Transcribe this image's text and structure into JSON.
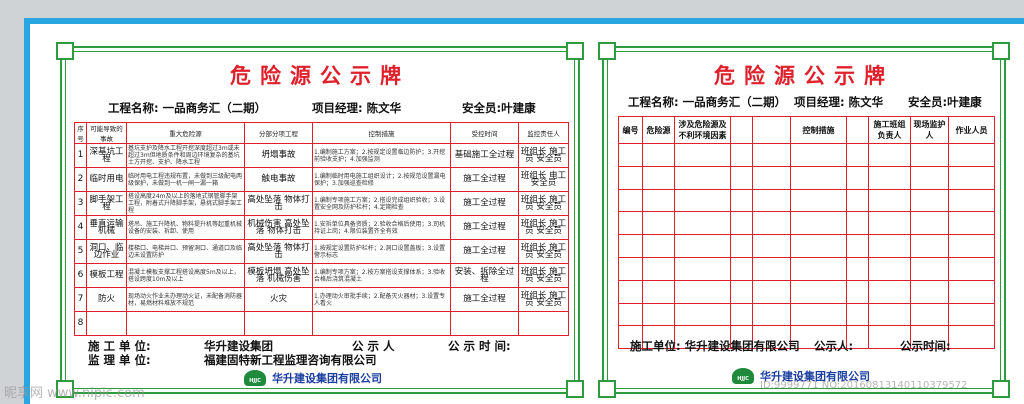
{
  "left": {
    "title": "危险源公示牌",
    "project": "工程名称: 一品商务汇（二期）",
    "manager": "项目经理: 陈文华",
    "safety_officer": "安全员:叶建康",
    "columns": [
      "序号",
      "可能导致的事故",
      "重大危险源",
      "分部分项工程",
      "控制措施",
      "受控时间",
      "监控责任人"
    ],
    "rows": [
      {
        "no": "1",
        "item": "深基坑工程",
        "hazard": "基坑支护及降水工程开挖深度超过3m或未超过3m但地质条件和周边环境复杂的基坑土方开挖、支护、降水工程",
        "sub": "坍塌事故",
        "measure": "1.编制施工方案；2.按规定设置临边防护；3.开挖前验收支护；4.加强监测",
        "time": "基础施工全过程",
        "person": "班组长 施工员 安全员"
      },
      {
        "no": "2",
        "item": "临时用电",
        "hazard": "临时用电工程违规布置，未做到三级配电两级保护，未做到一机一闸一漏一箱",
        "sub": "触电事故",
        "measure": "1.编制临时用电施工组织设计；2.按规范设置漏电保护；3.加强巡查检修",
        "time": "施工全过程",
        "person": "班组长 电工 安全员"
      },
      {
        "no": "3",
        "item": "脚手架工程",
        "hazard": "搭设高度24m及以上的落地式钢管脚手架工程，附着式升降脚手架，悬挑式脚手架工程",
        "sub": "高处坠落 物体打击",
        "measure": "1.编制专项施工方案；2.搭设完成组织验收；3.设置安全网及防护栏杆；4.定期检查",
        "time": "施工全过程",
        "person": "班组长 施工员 安全员"
      },
      {
        "no": "4",
        "item": "垂直运输机械",
        "hazard": "塔吊、施工升降机、物料提升机等起重机械设备的安装、拆卸、使用",
        "sub": "机械伤害 高处坠落 物体打击",
        "measure": "1.安拆单位具备资质；2.验收合格后使用；3.司机持证上岗；4.限位装置齐全有效",
        "time": "施工全过程",
        "person": "班组长 施工员 安全员"
      },
      {
        "no": "5",
        "item": "洞口、临边作业",
        "hazard": "楼梯口、电梯井口、预留洞口、通道口及临边未设置防护",
        "sub": "高处坠落 物体打击",
        "measure": "1.按规定设置防护栏杆；2.洞口设置盖板；3.设置警示标志",
        "time": "施工全过程",
        "person": "班组长 施工员 安全员"
      },
      {
        "no": "6",
        "item": "模板工程",
        "hazard": "混凝土模板支撑工程搭设高度5m及以上，搭设跨度10m及以上",
        "sub": "模板坍塌 高处坠落 机械伤害",
        "measure": "1.编制专项方案；2.按方案搭设支撑体系；3.验收合格后浇筑混凝土",
        "time": "安装、拆除全过程",
        "person": "班组长 施工员 安全员"
      },
      {
        "no": "7",
        "item": "防火",
        "hazard": "现场动火作业未办理动火证，未配备消防器材，易燃材料堆放不规范",
        "sub": "火灾",
        "measure": "1.办理动火审批手续；2.配备灭火器材；3.设置专人看火",
        "time": "施工全过程",
        "person": "班组长 施工员 安全员"
      },
      {
        "no": "8",
        "item": "",
        "hazard": "",
        "sub": "",
        "measure": "",
        "time": "",
        "person": ""
      }
    ],
    "footer": {
      "builder_label": "施 工 单 位:",
      "builder": "华升建设集团",
      "announcer_label": "公 示 人",
      "date_label": "公 示 时 间:",
      "supervisor_label": "监 理 单 位:",
      "supervisor": "福建固特新工程监理咨询有限公司"
    },
    "logo_text": "华升建设集团有限公司",
    "logo_mark": "HJJC"
  },
  "right": {
    "title": "危险源公示牌",
    "project": "工程名称: 一品商务汇（二期）",
    "manager": "项目经理: 陈文华",
    "safety_officer": "安全员:叶建康",
    "columns": [
      "编号",
      "危险源",
      "涉及危险源及不利环境因素",
      "",
      "",
      "控制措施",
      "",
      "施工班组负责人",
      "现场监护人",
      "作业人员"
    ],
    "footer": {
      "builder": "施工单位: 华升建设集团有限公司",
      "announcer": "公示人:",
      "date": "公示时间:"
    },
    "logo_text": "华升建设集团有限公司",
    "logo_mark": "HJJC"
  },
  "watermark_left": "昵享网 www.nipic.com",
  "watermark_right": "ID:9999771 NO:20160813140110379572",
  "colors": {
    "red": "#e0212b",
    "green_border": "#2e9b3e",
    "blue_frame": "#2aa7e0",
    "logo_blue": "#1b3fa0"
  }
}
